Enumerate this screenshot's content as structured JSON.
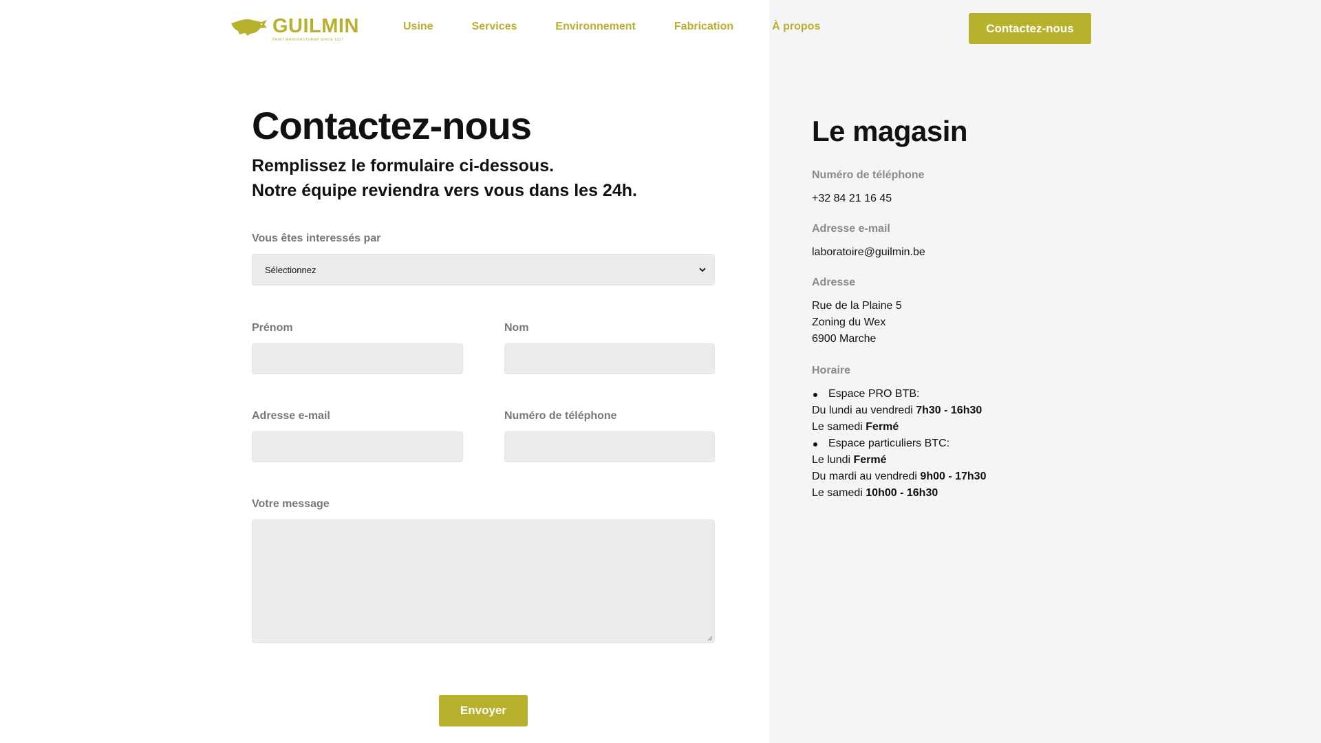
{
  "header": {
    "logo": {
      "name": "GUILMIN",
      "tagline": "PAINT MANUFACTURER SINCE 1937"
    },
    "nav": [
      "Usine",
      "Services",
      "Environnement",
      "Fabrication",
      "À propos"
    ],
    "cta_label": "Contactez-nous"
  },
  "form": {
    "title": "Contactez-nous",
    "subtitle_line1": "Remplissez le formulaire ci-dessous.",
    "subtitle_line2": "Notre équipe reviendra vers vous dans les 24h.",
    "interest_label": "Vous êtes interessés par",
    "interest_value": "Sélectionnez",
    "firstname_label": "Prénom",
    "lastname_label": "Nom",
    "email_label": "Adresse e-mail",
    "phone_label": "Numéro de téléphone",
    "message_label": "Votre message",
    "submit_label": "Envoyer"
  },
  "store": {
    "title": "Le magasin",
    "phone_label": "Numéro de téléphone",
    "phone": "+32 84 21 16 45",
    "email_label": "Adresse e-mail",
    "email": "laboratoire@guilmin.be",
    "address_label": "Adresse",
    "address_lines": [
      "Rue de la Plaine 5",
      "Zoning du Wex",
      "6900 Marche"
    ],
    "hours_label": "Horaire",
    "hours": {
      "pro_title": "Espace PRO BTB:",
      "pro_weekday_text": "Du lundi au vendredi",
      "pro_weekday_hours": "7h30 - 16h30",
      "pro_saturday_text": "Le samedi",
      "pro_saturday_hours": "Fermé",
      "btc_title": "Espace particuliers BTC:",
      "btc_monday_text": "Le lundi",
      "btc_monday_hours": "Fermé",
      "btc_weekday_text": "Du mardi au vendredi",
      "btc_weekday_hours": "9h00 - 17h30",
      "btc_saturday_text": "Le samedi",
      "btc_saturday_hours": "10h00 - 16h30"
    }
  },
  "colors": {
    "accent": "#b8b12e",
    "panel": "#f5f5f5",
    "input": "#ececec"
  }
}
